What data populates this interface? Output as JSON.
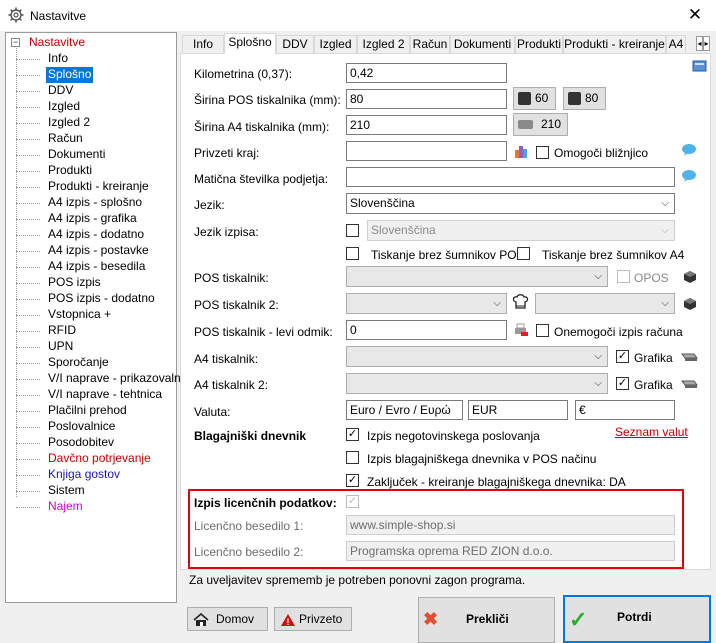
{
  "window": {
    "title": "Nastavitve",
    "close_symbol": "✕"
  },
  "tree": {
    "toggle": "−",
    "root": "Nastavitve",
    "items": [
      {
        "label": "Info",
        "style": ""
      },
      {
        "label": "Splošno",
        "style": "sel"
      },
      {
        "label": "DDV",
        "style": ""
      },
      {
        "label": "Izgled",
        "style": ""
      },
      {
        "label": "Izgled 2",
        "style": ""
      },
      {
        "label": "Račun",
        "style": ""
      },
      {
        "label": "Dokumenti",
        "style": ""
      },
      {
        "label": "Produkti",
        "style": ""
      },
      {
        "label": "Produkti - kreiranje",
        "style": ""
      },
      {
        "label": "A4 izpis - splošno",
        "style": ""
      },
      {
        "label": "A4 izpis - grafika",
        "style": ""
      },
      {
        "label": "A4 izpis - dodatno",
        "style": ""
      },
      {
        "label": "A4 izpis - postavke",
        "style": ""
      },
      {
        "label": "A4 izpis - besedila",
        "style": ""
      },
      {
        "label": "POS izpis",
        "style": ""
      },
      {
        "label": "POS izpis - dodatno",
        "style": ""
      },
      {
        "label": "Vstopnica +",
        "style": ""
      },
      {
        "label": "RFID",
        "style": ""
      },
      {
        "label": "UPN",
        "style": ""
      },
      {
        "label": "Sporočanje",
        "style": ""
      },
      {
        "label": "V/I naprave - prikazovalnik",
        "style": ""
      },
      {
        "label": "V/I naprave - tehtnica",
        "style": ""
      },
      {
        "label": "Plačilni prehod",
        "style": ""
      },
      {
        "label": "Poslovalnice",
        "style": ""
      },
      {
        "label": "Posodobitev",
        "style": ""
      },
      {
        "label": "Davčno potrjevanje",
        "style": "red"
      },
      {
        "label": "Knjiga gostov",
        "style": "blue"
      },
      {
        "label": "Sistem",
        "style": ""
      },
      {
        "label": "Najem",
        "style": "pink"
      }
    ]
  },
  "tabs": [
    "Info",
    "Splošno",
    "DDV",
    "Izgled",
    "Izgled 2",
    "Račun",
    "Dokumenti",
    "Produkti",
    "Produkti - kreiranje",
    "A4"
  ],
  "tab_scroll": {
    "left": "◂",
    "right": "▸"
  },
  "form": {
    "kilometrina": {
      "label": "Kilometrina (0,37):",
      "value": "0,42"
    },
    "sirina_pos": {
      "label": "Širina POS tiskalnika (mm):",
      "value": "80",
      "btn1": "60",
      "btn2": "80"
    },
    "sirina_a4": {
      "label": "Širina A4 tiskalnika (mm):",
      "value": "210",
      "btn": "210"
    },
    "privzeti_kraj": {
      "label": "Privzeti kraj:",
      "value": "",
      "check_label": "Omogoči bližnjico",
      "checked": false
    },
    "maticna": {
      "label": "Matična številka podjetja:",
      "value": ""
    },
    "jezik": {
      "label": "Jezik:",
      "value": "Slovenščina"
    },
    "jezik_izpisa": {
      "label": "Jezik izpisa:",
      "value": "Slovenščina"
    },
    "tisk_brez_pos": {
      "label": "Tiskanje brez šumnikov POS",
      "checked": false
    },
    "tisk_brez_a4": {
      "label": "Tiskanje brez šumnikov A4",
      "checked": false
    },
    "pos_tiskalnik": {
      "label": "POS tiskalnik:",
      "value": "",
      "opos_label": "OPOS"
    },
    "pos_tiskalnik2": {
      "label": "POS tiskalnik 2:",
      "value": "",
      "value2": ""
    },
    "pos_levi_odmik": {
      "label": "POS tiskalnik - levi odmik:",
      "value": "0",
      "check_label": "Onemogoči izpis računa",
      "checked": false
    },
    "a4_tiskalnik": {
      "label": "A4 tiskalnik:",
      "value": "",
      "check_label": "Grafika",
      "checked": true
    },
    "a4_tiskalnik2": {
      "label": "A4 tiskalnik 2:",
      "value": "",
      "check_label": "Grafika",
      "checked": true
    },
    "valuta": {
      "label": "Valuta:",
      "name": "Euro / Evro / Ευρώ",
      "code": "EUR",
      "symbol": "€",
      "link": "Seznam valut"
    },
    "blagajniski": {
      "heading": "Blagajniški dnevnik",
      "opt1": "Izpis negotovinskega poslovanja",
      "opt2": "Izpis blagajniškega dnevnika v POS načinu",
      "opt3": "Zaključek - kreiranje blagajniškega dnevnika: DA",
      "checks": [
        true,
        false,
        true
      ]
    },
    "licence": {
      "heading": "Izpis licenčnih podatkov:",
      "line1_label": "Licenčno besedilo 1:",
      "line1_value": "www.simple-shop.si",
      "line2_label": "Licenčno besedilo 2:",
      "line2_value": "Programska oprema RED ZION d.o.o."
    }
  },
  "note": "Za uveljavitev sprememb je potreben ponovni zagon programa.",
  "buttons": {
    "domov": "Domov",
    "privzeto": "Privzeto",
    "preklici": "Prekliči",
    "potrdi": "Potrdi"
  },
  "icons": {
    "check_mark": "✓",
    "chevron": "⌵",
    "cross": "✖",
    "warning": "!"
  },
  "colors": {
    "selection": "#0078d7",
    "red_frame": "#e0000d",
    "link_red": "#c00000"
  }
}
